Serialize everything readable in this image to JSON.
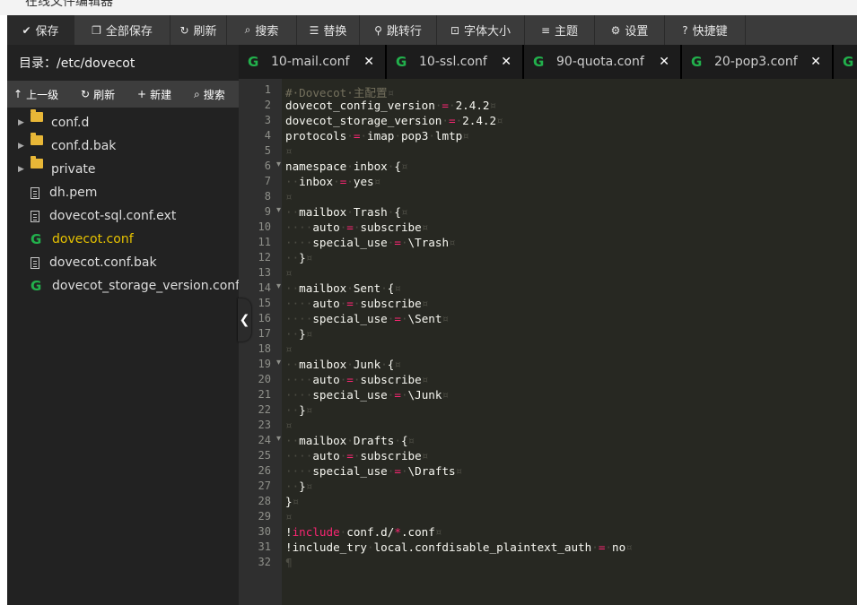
{
  "window": {
    "title": "在线文件编辑器"
  },
  "toolbar": [
    {
      "icon": "check-icon",
      "glyph": "✔",
      "label": "保存"
    },
    {
      "icon": "copy-icon",
      "glyph": "❐",
      "label": "全部保存"
    },
    {
      "icon": "refresh-icon",
      "glyph": "↻",
      "label": "刷新"
    },
    {
      "icon": "search-icon",
      "glyph": "⌕",
      "label": "搜索"
    },
    {
      "icon": "replace-icon",
      "glyph": "☰",
      "label": "替换"
    },
    {
      "icon": "goto-line-icon",
      "glyph": "⚲",
      "label": "跳转行"
    },
    {
      "icon": "font-size-icon",
      "glyph": "⊡",
      "label": "字体大小"
    },
    {
      "icon": "theme-icon",
      "glyph": "≡",
      "label": "主题"
    },
    {
      "icon": "settings-icon",
      "glyph": "⚙",
      "label": "设置"
    },
    {
      "icon": "help-icon",
      "glyph": "?",
      "label": "快捷键"
    }
  ],
  "sidebar": {
    "title": "目录：/etc/dovecot",
    "tools": [
      {
        "icon": "arrow-up-icon",
        "glyph": "↑",
        "label": "上一级"
      },
      {
        "icon": "refresh-icon",
        "glyph": "↻",
        "label": "刷新"
      },
      {
        "icon": "plus-icon",
        "glyph": "+",
        "label": "新建"
      },
      {
        "icon": "search-icon",
        "glyph": "⌕",
        "label": "搜索"
      }
    ],
    "items": [
      {
        "name": "conf.d",
        "type": "folder"
      },
      {
        "name": "conf.d.bak",
        "type": "folder"
      },
      {
        "name": "private",
        "type": "folder"
      },
      {
        "name": "dh.pem",
        "type": "file"
      },
      {
        "name": "dovecot-sql.conf.ext",
        "type": "file"
      },
      {
        "name": "dovecot.conf",
        "type": "conf",
        "selected": true
      },
      {
        "name": "dovecot.conf.bak",
        "type": "file"
      },
      {
        "name": "dovecot_storage_version.conf",
        "type": "conf"
      }
    ]
  },
  "tabs": [
    {
      "name": "10-mail.conf"
    },
    {
      "name": "10-ssl.conf"
    },
    {
      "name": "90-quota.conf"
    },
    {
      "name": "20-pop3.conf"
    }
  ],
  "editor": {
    "lines": [
      "# Dovecot 主配置",
      "dovecot_config_version = 2.4.2",
      "dovecot_storage_version = 2.4.2",
      "protocols = imap pop3 lmtp",
      "",
      "namespace inbox {",
      "  inbox = yes",
      "",
      "  mailbox Trash {",
      "    auto = subscribe",
      "    special_use = \\Trash",
      "  }",
      "",
      "  mailbox Sent {",
      "    auto = subscribe",
      "    special_use = \\Sent",
      "  }",
      "",
      "  mailbox Junk {",
      "    auto = subscribe",
      "    special_use = \\Junk",
      "  }",
      "",
      "  mailbox Drafts {",
      "    auto = subscribe",
      "    special_use = \\Drafts",
      "  }",
      "}",
      "",
      "!include conf.d/*.conf",
      "!include_try local.confdisable_plaintext_auth = no",
      ""
    ],
    "fold_lines": [
      6,
      9,
      14,
      19,
      24
    ]
  },
  "colors": {
    "toolbar_bg": "#3b3b3b",
    "sidebar_bg": "#222222",
    "editor_bg": "#272822",
    "selected_file": "#e6c200",
    "conf_icon": "#22b14c"
  }
}
